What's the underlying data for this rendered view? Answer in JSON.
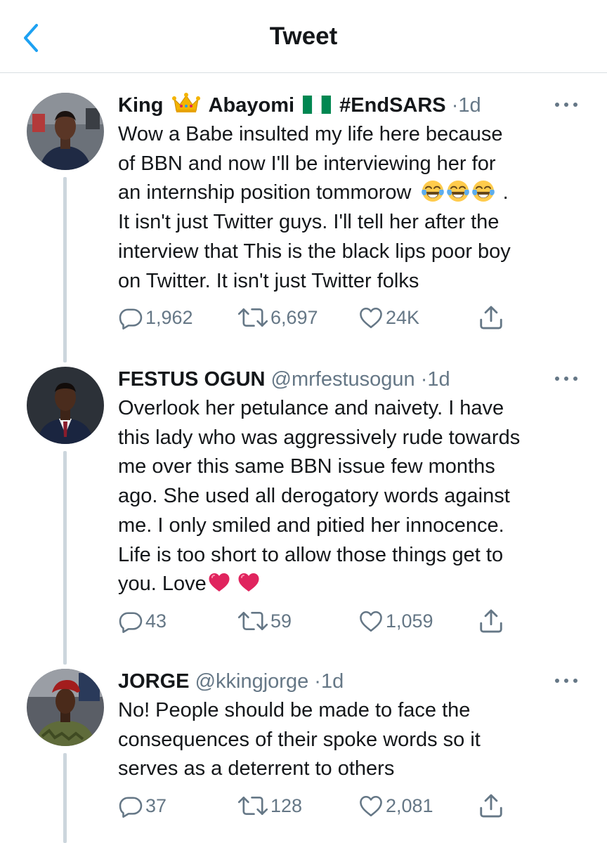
{
  "header": {
    "title": "Tweet"
  },
  "tweets": [
    {
      "name_part1": "King",
      "name_part2": "Abayomi",
      "name_part3": "#EndSARS",
      "handle": "",
      "separator": "·",
      "time": "1d",
      "lines": [
        "Wow a Babe insulted my life here because",
        "of BBN and now I'll be interviewing her for",
        "an internship position tommorow",
        "It isn't just Twitter guys. I'll tell her after the",
        "interview that This is the black lips poor boy",
        "on Twitter. It isn't just Twitter folks"
      ],
      "line3_tail": ".",
      "replies": "1,962",
      "retweets": "6,697",
      "likes": "24K",
      "icons": {
        "name_badge_1": "crown-emoji",
        "name_badge_2": "nigeria-flag",
        "inline": "tears-of-joy-emoji"
      }
    },
    {
      "name": "FESTUS OGUN",
      "handle": "@mrfestusogun",
      "separator": "·",
      "time": "1d",
      "lines": [
        "Overlook her petulance and naivety. I have",
        "this lady who was aggressively rude towards",
        "me over this same BBN issue few months",
        "ago. She used all derogatory words against",
        "me. I only smiled and pitied her innocence.",
        "Life is too short to allow those things get to",
        "you. Love"
      ],
      "replies": "43",
      "retweets": "59",
      "likes": "1,059",
      "icons": {
        "inline": "red-heart-emoji"
      }
    },
    {
      "name": "JORGE",
      "handle": "@kkingjorge",
      "separator": "·",
      "time": "1d",
      "lines": [
        "No! People should be made to face the",
        "consequences of their spoke  words so it",
        "serves as a deterrent to others"
      ],
      "replies": "37",
      "retweets": "128",
      "likes": "2,081"
    }
  ],
  "colors": {
    "link_blue": "#1da1f2",
    "muted": "#657786",
    "text": "#14171a",
    "divider": "#d9dee2",
    "thread": "#ccd6dd"
  }
}
